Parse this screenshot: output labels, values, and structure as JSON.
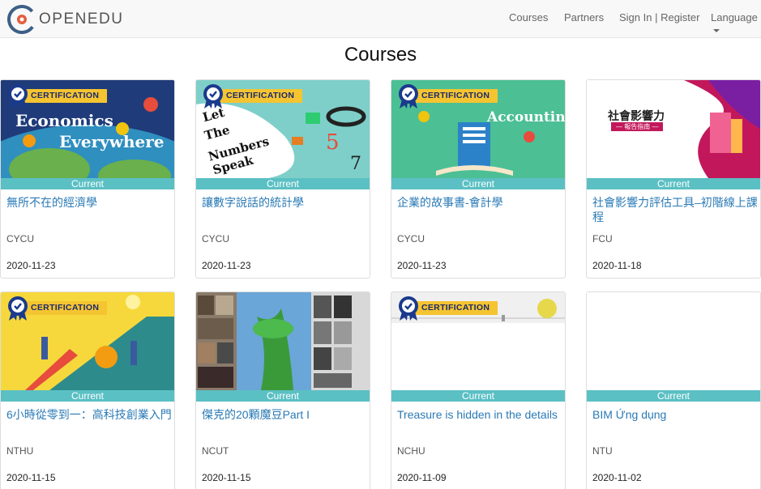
{
  "header": {
    "logo_text": "OPENEDU",
    "nav": [
      "Courses",
      "Partners",
      "Sign In | Register",
      "Language"
    ]
  },
  "page_title": "Courses",
  "certification_label": "CERTIFICATION",
  "status_label": "Current",
  "thumb_texts": {
    "econ_1": "Economics",
    "econ_2": "Everywhere",
    "stats_1": "Let",
    "stats_2": "The",
    "stats_3": "Numbers",
    "stats_4": "Speak",
    "acct": "-Accounting",
    "impact_title": "社會影響力",
    "impact_sub": "— 報告指南 —"
  },
  "courses": [
    {
      "title": "無所不在的經濟學",
      "school": "CYCU",
      "date": "2020-11-23",
      "certification": true
    },
    {
      "title": "讓數字說話的統計學",
      "school": "CYCU",
      "date": "2020-11-23",
      "certification": true
    },
    {
      "title": "企業的故事書-會計學",
      "school": "CYCU",
      "date": "2020-11-23",
      "certification": true
    },
    {
      "title": "社會影響力評估工具–初階線上課程",
      "school": "FCU",
      "date": "2020-11-18",
      "certification": false
    },
    {
      "title": "6小時從零到一：高科技創業入門",
      "school": "NTHU",
      "date": "2020-11-15",
      "certification": true
    },
    {
      "title": "傑克的20顆魔豆Part I",
      "school": "NCUT",
      "date": "2020-11-15",
      "certification": false
    },
    {
      "title": "Treasure is hidden in the details",
      "school": "NCHU",
      "date": "2020-11-09",
      "certification": true
    },
    {
      "title": "BIM Ứng dụng",
      "school": "NTU",
      "date": "2020-11-02",
      "certification": false
    }
  ],
  "colors": {
    "accent": "#5bc0c4",
    "link": "#2a7ab5",
    "ribbon": "#f5c431",
    "medal": "#1a3a8c"
  }
}
